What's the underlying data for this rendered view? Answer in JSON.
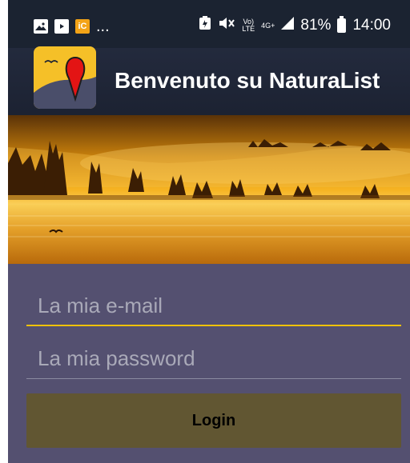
{
  "status_bar": {
    "ellipsis": "...",
    "app_icon_text": "iC",
    "signal_volte": "Vo)",
    "signal_lte": "LTE",
    "network": "4G+",
    "battery": "81%",
    "time": "14:00"
  },
  "header": {
    "title": "Benvenuto su NaturaList"
  },
  "login_form": {
    "email_placeholder": "La mia e-mail",
    "email_value": "",
    "password_placeholder": "La mia password",
    "password_value": "",
    "login_label": "Login"
  },
  "colors": {
    "status_bar": "#1b2331",
    "background": "#545070",
    "accent": "#f2c200",
    "button": "#615632",
    "banner_sunlight": "#f5a623"
  },
  "icons": [
    "image-icon",
    "youtube-icon",
    "app-notification-icon",
    "battery-saver-icon",
    "mute-icon",
    "signal-icon",
    "battery-icon",
    "map-pin-icon",
    "bird-icon"
  ]
}
